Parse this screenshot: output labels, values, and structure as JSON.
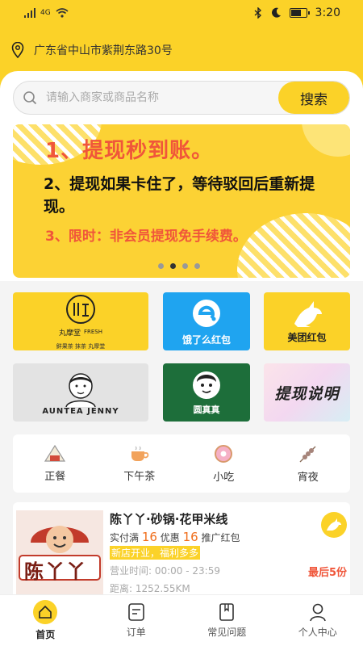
{
  "status": {
    "time": "3:20",
    "network": "4G",
    "battery_percent": 60
  },
  "location": {
    "icon": "location-pin-icon",
    "address": "广东省中山市紫荆东路30号"
  },
  "search": {
    "placeholder": "请输入商家或商品名称",
    "button_label": "搜索"
  },
  "banner": {
    "line1": "1、提现秒到账。",
    "line2": "2、提现如果卡住了，等待驳回后重新提现。",
    "line3": "3、限时：非会员提现免手续费。",
    "active_dot": 1,
    "dot_count": 4
  },
  "tiles": {
    "wanmotang": {
      "brand": "丸摩堂",
      "brand_en": "FRESH",
      "slogan": "鲜果茶 抹茶 丸摩堂"
    },
    "eleme": {
      "label": "饿了么红包"
    },
    "meituan": {
      "label": "美团红包"
    },
    "auntea": {
      "label": "AUNTEA JENNY"
    },
    "yuanzhenzhen": {
      "label": "圆真真"
    },
    "withdraw": {
      "label": "提现说明"
    }
  },
  "categories": [
    {
      "label": "正餐",
      "icon": "rice-ball-icon"
    },
    {
      "label": "下午茶",
      "icon": "tea-cup-icon"
    },
    {
      "label": "小吃",
      "icon": "donut-icon"
    },
    {
      "label": "宵夜",
      "icon": "skewer-icon"
    }
  ],
  "shop": {
    "name": "陈丫丫·砂锅·花甲米线",
    "logo_text": "陈丫丫",
    "promo_prefix": "实付满",
    "promo_amount": "16",
    "promo_mid": "优惠",
    "promo_bonus": "16",
    "promo_suffix": "推广红包",
    "notice": "新店开业，福利多多",
    "hours": "营业时间:  00:00 - 23:59",
    "distance": "距离:  1252.55KM",
    "remaining": "最后5份"
  },
  "tabbar": [
    {
      "label": "首页",
      "icon": "home-icon",
      "active": true
    },
    {
      "label": "订单",
      "icon": "order-icon",
      "active": false
    },
    {
      "label": "常见问题",
      "icon": "book-icon",
      "active": false
    },
    {
      "label": "个人中心",
      "icon": "person-icon",
      "active": false
    }
  ],
  "colors": {
    "accent": "#fbd228",
    "red": "#f0563a",
    "orange": "#f06e1c"
  }
}
